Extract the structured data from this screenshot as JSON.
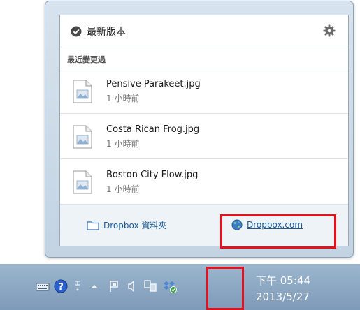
{
  "header": {
    "status": "最新版本"
  },
  "recent": {
    "label": "最近變更過",
    "files": [
      {
        "name": "Pensive Parakeet.jpg",
        "time": "1 小時前"
      },
      {
        "name": "Costa Rican Frog.jpg",
        "time": "1 小時前"
      },
      {
        "name": "Boston City Flow.jpg",
        "time": "1 小時前"
      }
    ]
  },
  "footer": {
    "folder": "Dropbox 資料夾",
    "website": "Dropbox.com"
  },
  "taskbar": {
    "time": "下午 05:44",
    "date": "2013/5/27"
  },
  "colors": {
    "highlight": "#e8101a",
    "link": "#1b5c98"
  }
}
